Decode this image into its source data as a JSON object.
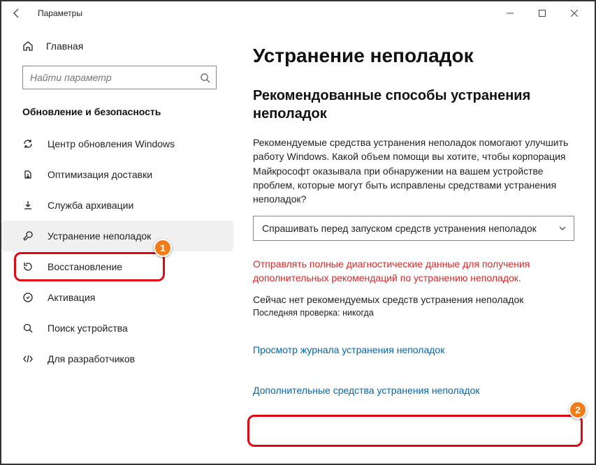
{
  "window": {
    "title": "Параметры"
  },
  "sidebar": {
    "home": "Главная",
    "search_placeholder": "Найти параметр",
    "section": "Обновление и безопасность",
    "items": [
      {
        "label": "Центр обновления Windows"
      },
      {
        "label": "Оптимизация доставки"
      },
      {
        "label": "Служба архивации"
      },
      {
        "label": "Устранение неполадок"
      },
      {
        "label": "Восстановление"
      },
      {
        "label": "Активация"
      },
      {
        "label": "Поиск устройства"
      },
      {
        "label": "Для разработчиков"
      }
    ]
  },
  "main": {
    "h1": "Устранение неполадок",
    "h2": "Рекомендованные способы устранения неполадок",
    "desc": "Рекомендуемые средства устранения неполадок помогают улучшить работу Windows. Какой объем помощи вы хотите, чтобы корпорация Майкрософт оказывала при обнаружении на вашем устройстве проблем, которые могут быть исправлены средствами устранения неполадок?",
    "dropdown_value": "Спрашивать перед запуском средств устранения неполадок",
    "red_note": "Отправлять полные диагностические данные для получения дополнительных рекомендаций по устранению неполадок.",
    "info": "Сейчас нет рекомендуемых средств устранения неполадок",
    "last_check": "Последняя проверка: никогда",
    "link_history": "Просмотр журнала устранения неполадок",
    "link_more": "Дополнительные средства устранения неполадок"
  },
  "annotations": {
    "b1": "1",
    "b2": "2"
  }
}
